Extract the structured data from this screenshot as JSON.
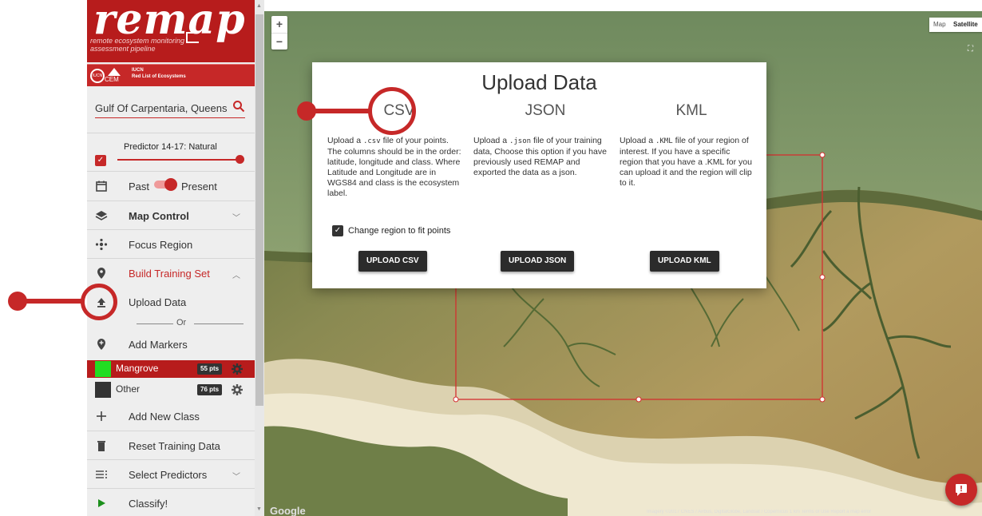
{
  "brand": {
    "name": "remap",
    "tagline": "remote ecosystem monitoring assessment pipeline",
    "partner_short": "IUCN",
    "partner_long": "Red List of Ecosystems",
    "partner_cem": "CEM"
  },
  "search": {
    "value": "Gulf Of Carpentaria, Queensla"
  },
  "sidebar": {
    "predictor_label": "Predictor 14-17: Natural",
    "past_label": "Past",
    "present_label": "Present",
    "map_control": "Map Control",
    "focus_region": "Focus Region",
    "build_training": "Build Training Set",
    "upload_data": "Upload Data",
    "or_label": "Or",
    "add_markers": "Add Markers",
    "classes": [
      {
        "name": "Mangrove",
        "points": "55 pts",
        "color": "#22dd22"
      },
      {
        "name": "Other",
        "points": "76 pts",
        "color": "#333333"
      }
    ],
    "add_new_class": "Add New Class",
    "reset_training": "Reset Training Data",
    "select_predictors": "Select Predictors",
    "classify": "Classify!"
  },
  "map": {
    "type_map": "Map",
    "type_satellite": "Satellite",
    "zoom_in": "+",
    "zoom_out": "−",
    "google": "Google",
    "credits": "Imagery ©2017 CNES / Airbus, DigitalGlobe, Landsat / Copernicus   1 km   Terms of Use   Report a map error"
  },
  "modal": {
    "title": "Upload Data",
    "csv": {
      "heading": "CSV",
      "desc_1": "Upload a",
      "code": ".csv",
      "desc_2": "file of your points. The columns should be in the order: latitude, longitude and class. Where Latitude and Longitude are in WGS84 and class is the ecosystem label.",
      "checkbox_label": "Change region to fit points",
      "button": "UPLOAD CSV"
    },
    "json": {
      "heading": "JSON",
      "desc_1": "Upload a",
      "code": ".json",
      "desc_2": "file of your training data, Choose this option if you have previously used REMAP and exported the data as a json.",
      "button": "UPLOAD JSON"
    },
    "kml": {
      "heading": "KML",
      "desc_1": "Upload a",
      "code": ".KML",
      "desc_2": "file of your region of interest. If you have a specific region that you have a .KML for you can upload it and the region will clip to it.",
      "button": "UPLOAD KML"
    }
  },
  "colors": {
    "accent": "#c62828",
    "dark": "#2b2b2b"
  }
}
